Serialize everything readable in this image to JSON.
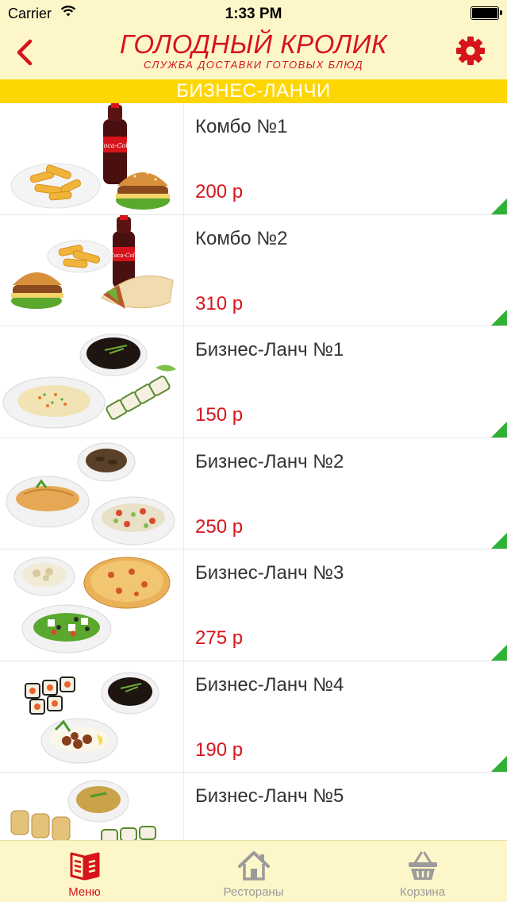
{
  "status_bar": {
    "carrier": "Carrier",
    "time": "1:33 PM"
  },
  "header": {
    "brand_name": "ГОЛОДНЫЙ КРОЛИК",
    "brand_tagline": "СЛУЖБА ДОСТАВКИ ГОТОВЫХ БЛЮД",
    "back_icon": "chevron-left-icon",
    "settings_icon": "gear-icon"
  },
  "section_title": "БИЗНЕС-ЛАНЧИ",
  "items": [
    {
      "name": "Комбо №1",
      "price": "200 р"
    },
    {
      "name": "Комбо №2",
      "price": "310 р"
    },
    {
      "name": "Бизнес-Ланч №1",
      "price": "150 р"
    },
    {
      "name": "Бизнес-Ланч №2",
      "price": "250 р"
    },
    {
      "name": "Бизнес-Ланч №3",
      "price": "275 р"
    },
    {
      "name": "Бизнес-Ланч №4",
      "price": "190 р"
    },
    {
      "name": "Бизнес-Ланч №5",
      "price": ""
    }
  ],
  "tabs": [
    {
      "label": "Меню",
      "icon": "menu-book-icon",
      "active": true
    },
    {
      "label": "Рестораны",
      "icon": "house-icon",
      "active": false
    },
    {
      "label": "Корзина",
      "icon": "basket-icon",
      "active": false
    }
  ],
  "colors": {
    "accent_red": "#d7141b",
    "section_yellow": "#fed601",
    "bar_cream": "#fdf6c8",
    "corner_green": "#2eb135"
  }
}
